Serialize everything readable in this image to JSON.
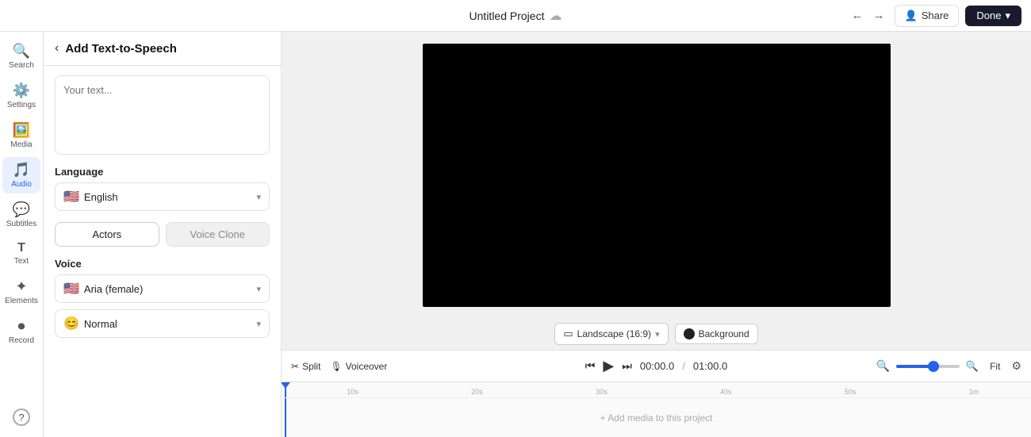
{
  "topbar": {
    "project_title": "Untitled Project",
    "share_label": "Share",
    "done_label": "Done",
    "undo_icon": "←",
    "redo_icon": "→"
  },
  "sidebar": {
    "items": [
      {
        "id": "search",
        "label": "Search",
        "icon": "🔍",
        "active": false
      },
      {
        "id": "settings",
        "label": "Settings",
        "icon": "⚙️",
        "active": false
      },
      {
        "id": "media",
        "label": "Media",
        "icon": "🖼️",
        "active": false
      },
      {
        "id": "audio",
        "label": "Audio",
        "icon": "🎵",
        "active": true
      },
      {
        "id": "subtitles",
        "label": "Subtitles",
        "icon": "💬",
        "active": false
      },
      {
        "id": "text",
        "label": "Text",
        "icon": "T",
        "active": false
      },
      {
        "id": "elements",
        "label": "Elements",
        "icon": "✦",
        "active": false
      },
      {
        "id": "record",
        "label": "Record",
        "icon": "⏺",
        "active": false
      }
    ],
    "help_icon": "?"
  },
  "panel": {
    "back_icon": "‹",
    "title": "Add Text-to-Speech",
    "textarea_placeholder": "Your text...",
    "language_section": "Language",
    "language_flag": "🇺🇸",
    "language_value": "English",
    "tabs": [
      {
        "id": "actors",
        "label": "Actors",
        "active": true
      },
      {
        "id": "voice-clone",
        "label": "Voice Clone",
        "active": false
      }
    ],
    "voice_section": "Voice",
    "voice_flag": "🇺🇸",
    "voice_value": "Aria (female)",
    "style_value": "Normal",
    "style_icon": "😊"
  },
  "canvas": {
    "landscape_label": "Landscape (16:9)",
    "background_label": "Background"
  },
  "timeline": {
    "split_label": "Split",
    "voiceover_label": "Voiceover",
    "current_time": "00:00.0",
    "separator": "/",
    "total_time": "01:00.0",
    "fit_label": "Fit",
    "add_media_label": "+ Add media to this project",
    "ruler_marks": [
      "",
      "10s",
      "",
      "20s",
      "",
      "30s",
      "",
      "40s",
      "",
      "50s",
      "",
      "1m"
    ],
    "zoom_value": 60
  }
}
